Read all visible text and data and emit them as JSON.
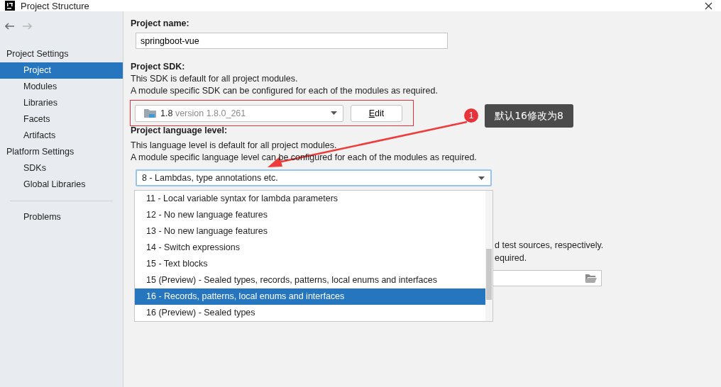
{
  "window": {
    "title": "Project Structure"
  },
  "sidebar": {
    "sections": [
      {
        "heading": "Project Settings",
        "items": [
          {
            "label": "Project",
            "selected": true
          },
          {
            "label": "Modules",
            "selected": false
          },
          {
            "label": "Libraries",
            "selected": false
          },
          {
            "label": "Facets",
            "selected": false
          },
          {
            "label": "Artifacts",
            "selected": false
          }
        ]
      },
      {
        "heading": "Platform Settings",
        "items": [
          {
            "label": "SDKs",
            "selected": false
          },
          {
            "label": "Global Libraries",
            "selected": false
          }
        ]
      }
    ],
    "footer_items": [
      {
        "label": "Problems",
        "selected": false
      }
    ]
  },
  "project_name": {
    "label": "Project name:",
    "value": "springboot-vue"
  },
  "project_sdk": {
    "label": "Project SDK:",
    "description": [
      "This SDK is default for all project modules.",
      "A module specific SDK can be configured for each of the modules as required."
    ],
    "sdk_name": "1.8",
    "sdk_version": "version 1.8.0_261",
    "edit_button": "Edit"
  },
  "language_level": {
    "label": "Project language level:",
    "description": [
      "This language level is default for all project modules.",
      "A module specific language level can be configured for each of the modules as required."
    ],
    "value": "8 - Lambdas, type annotations etc.",
    "options": [
      {
        "label": "11 - Local variable syntax for lambda parameters",
        "selected": false
      },
      {
        "label": "12 - No new language features",
        "selected": false
      },
      {
        "label": "13 - No new language features",
        "selected": false
      },
      {
        "label": "14 - Switch expressions",
        "selected": false
      },
      {
        "label": "15 - Text blocks",
        "selected": false
      },
      {
        "label": "15 (Preview) - Sealed types, records, patterns, local enums and interfaces",
        "selected": false
      },
      {
        "label": "16 - Records, patterns, local enums and interfaces",
        "selected": true
      },
      {
        "label": "16 (Preview) - Sealed types",
        "selected": false
      }
    ]
  },
  "covered_section": {
    "line_fragments": [
      "d test sources, respectively.",
      "equired."
    ]
  },
  "annotation": {
    "badge": "1",
    "note": "默认16修改为8"
  }
}
